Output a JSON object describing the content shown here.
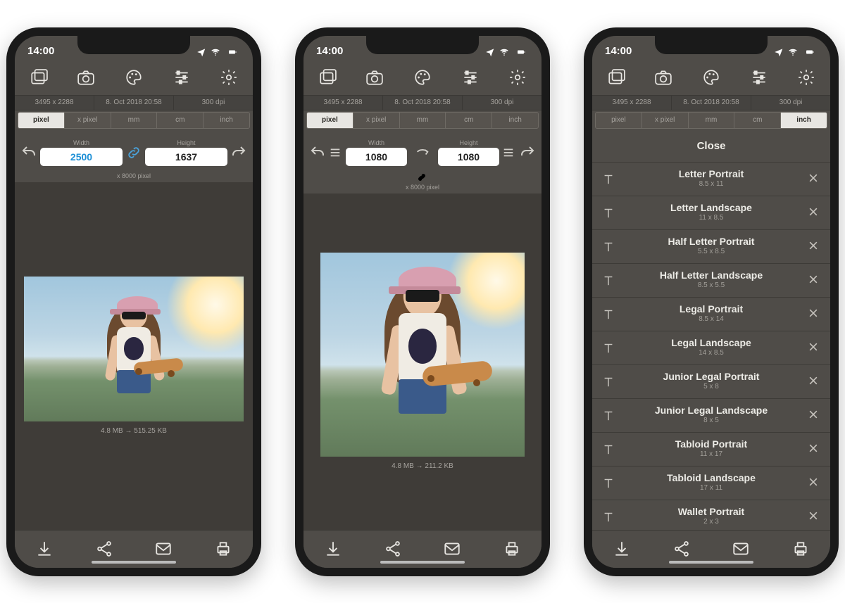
{
  "status": {
    "time": "14:00"
  },
  "toolbar_icons": [
    "gallery-icon",
    "camera-icon",
    "palette-icon",
    "sliders-icon",
    "settings-icon"
  ],
  "infostrip": {
    "resolution": "3495 x 2288",
    "date": "8. Oct 2018 20:58",
    "dpi": "300 dpi"
  },
  "units": [
    "pixel",
    "x pixel",
    "mm",
    "cm",
    "inch"
  ],
  "screen1": {
    "active_unit_index": 0,
    "width_label": "Width",
    "height_label": "Height",
    "width_value": "2500",
    "height_value": "1637",
    "subnote": "x 8000 pixel",
    "sizeinfo": "4.8 MB  →  515.25 KB"
  },
  "screen2": {
    "active_unit_index": 0,
    "width_label": "Width",
    "height_label": "Height",
    "width_value": "1080",
    "height_value": "1080",
    "subnote": "x 8000 pixel",
    "sizeinfo": "4.8 MB  →  211.2 KB"
  },
  "screen3": {
    "active_unit_index": 4,
    "close_label": "Close",
    "presets": [
      {
        "name": "Letter Portrait",
        "dim": "8.5 x 11"
      },
      {
        "name": "Letter Landscape",
        "dim": "11 x 8.5"
      },
      {
        "name": "Half Letter Portrait",
        "dim": "5.5 x 8.5"
      },
      {
        "name": "Half Letter Landscape",
        "dim": "8.5 x 5.5"
      },
      {
        "name": "Legal Portrait",
        "dim": "8.5 x 14"
      },
      {
        "name": "Legal Landscape",
        "dim": "14 x 8.5"
      },
      {
        "name": "Junior Legal Portrait",
        "dim": "5 x 8"
      },
      {
        "name": "Junior Legal Landscape",
        "dim": "8 x 5"
      },
      {
        "name": "Tabloid Portrait",
        "dim": "11 x 17"
      },
      {
        "name": "Tabloid Landscape",
        "dim": "17 x 11"
      },
      {
        "name": "Wallet Portrait",
        "dim": "2 x 3"
      }
    ]
  },
  "bottombar_icons": [
    "download-icon",
    "share-icon",
    "mail-icon",
    "print-icon"
  ]
}
